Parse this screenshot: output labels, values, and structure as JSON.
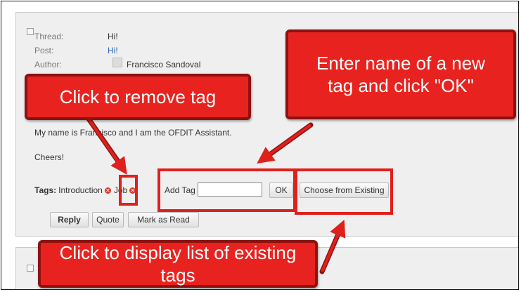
{
  "post": {
    "thread_label": "Thread:",
    "thread_value": "Hi!",
    "post_label": "Post:",
    "post_value": "Hi!",
    "author_label": "Author:",
    "author_value": "Francisco Sandoval",
    "body_line": "My name is Francisco and I am the OFDIT Assistant.",
    "signoff": "Cheers!",
    "tags_label": "Tags:",
    "tags": [
      {
        "label": "Introduction"
      },
      {
        "label": "Job"
      }
    ],
    "add_tag_label": "Add Tag",
    "add_tag_value": "",
    "ok_button": "OK",
    "choose_existing_button": "Choose from Existing",
    "reply_button": "Reply",
    "quote_button": "Quote",
    "mark_read_button": "Mark as Read"
  },
  "callouts": {
    "remove_tag": "Click to remove tag",
    "new_tag_line1": "Enter name of a new",
    "new_tag_line2": "tag and click \"OK\"",
    "existing_tags": "Click to display list of existing tags"
  },
  "colors": {
    "callout_fill": "#e8231f",
    "callout_border": "#8c1210",
    "highlight": "#e0201c",
    "card_bg": "#efefef",
    "link": "#2a6ab0"
  },
  "icons": {
    "tag_remove": "remove-circle-icon",
    "checkbox": "checkbox-icon"
  }
}
